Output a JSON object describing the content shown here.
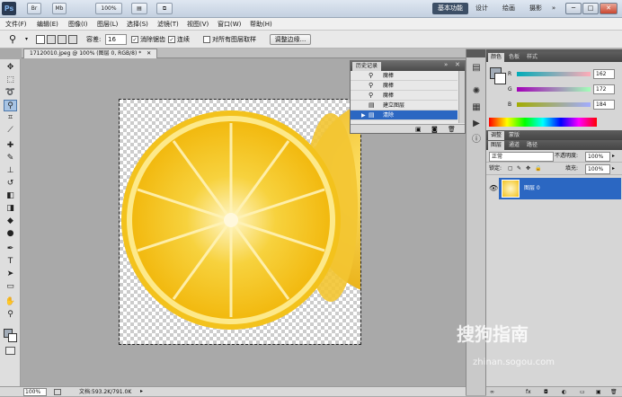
{
  "titlebar": {
    "logo": "Ps",
    "buttons": [
      "Br",
      "Mb",
      "100%",
      "▤",
      "⧉"
    ],
    "workspaces": [
      "基本功能",
      "设计",
      "绘画",
      "摄影",
      "»"
    ],
    "window_controls": [
      "─",
      "□",
      "✕"
    ]
  },
  "menu": [
    "文件(F)",
    "编辑(E)",
    "图像(I)",
    "图层(L)",
    "选择(S)",
    "滤镜(T)",
    "视图(V)",
    "窗口(W)",
    "帮助(H)"
  ],
  "options": {
    "tolerance_label": "容差:",
    "tolerance_value": "16",
    "antialias_label": "消除锯齿",
    "contiguous_label": "连续",
    "sample_all_label": "对所有图层取样",
    "refine_button": "调整边缘..."
  },
  "document": {
    "tab_title": "17120010.jpeg @ 100% (图层 0, RGB/8) *",
    "zoom": "100%",
    "doc_size": "文档:593.2K/791.0K"
  },
  "history": {
    "tab": "历史记录",
    "items": [
      "魔棒",
      "魔棒",
      "魔棒",
      "建立图层",
      "清除"
    ],
    "selected_index": 4
  },
  "color_panel": {
    "tabs": [
      "颜色",
      "色板",
      "样式"
    ],
    "channels": [
      {
        "label": "R",
        "value": "162"
      },
      {
        "label": "G",
        "value": "172"
      },
      {
        "label": "B",
        "value": "184"
      }
    ]
  },
  "adjust_panel": {
    "tabs": [
      "调整",
      "蒙版"
    ]
  },
  "layers_panel": {
    "tabs": [
      "图层",
      "通道",
      "路径"
    ],
    "blend_mode": "正常",
    "opacity_label": "不透明度:",
    "opacity_value": "100%",
    "lock_label": "锁定:",
    "fill_label": "填充:",
    "fill_value": "100%",
    "layers": [
      {
        "name": "图层 0",
        "visible": true
      }
    ]
  },
  "watermark": {
    "brand": "搜狗指南",
    "url": "zhinan.sogou.com"
  },
  "colors": {
    "selection": "#2b67c2",
    "accent_workspace": "#3d4f66",
    "lemon": "#f6c21a"
  }
}
